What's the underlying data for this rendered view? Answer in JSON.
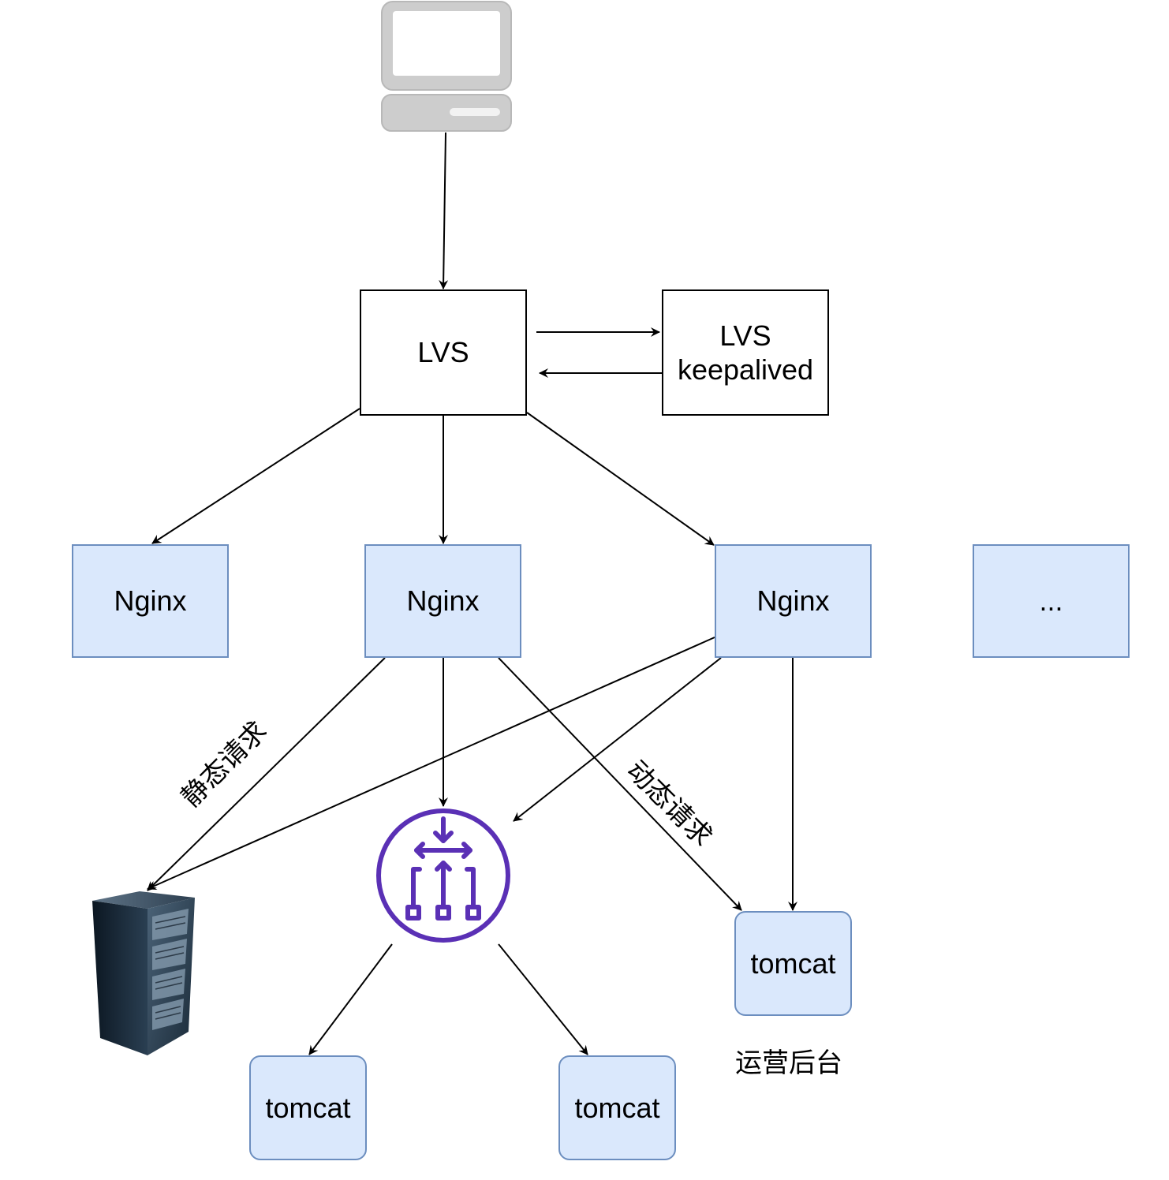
{
  "nodes": {
    "lvs": {
      "label": "LVS"
    },
    "lvs_keepalived": {
      "label": "LVS\nkeepalived"
    },
    "nginx_1": {
      "label": "Nginx"
    },
    "nginx_2": {
      "label": "Nginx"
    },
    "nginx_3": {
      "label": "Nginx"
    },
    "more": {
      "label": "..."
    },
    "tomcat_left": {
      "label": "tomcat"
    },
    "tomcat_mid": {
      "label": "tomcat"
    },
    "tomcat_admin": {
      "label": "tomcat"
    }
  },
  "labels": {
    "static_request": "静态请求",
    "dynamic_request": "动态请求",
    "admin_backend": "运营后台"
  },
  "icons": {
    "client": "desktop-computer-icon",
    "static_server": "server-rack-icon",
    "load_balancer": "load-balancer-icon"
  },
  "colors": {
    "nginx_fill": "#dae8fc",
    "nginx_stroke": "#6c8ebf",
    "load_balancer": "#5a30b5",
    "edge": "#000000"
  }
}
